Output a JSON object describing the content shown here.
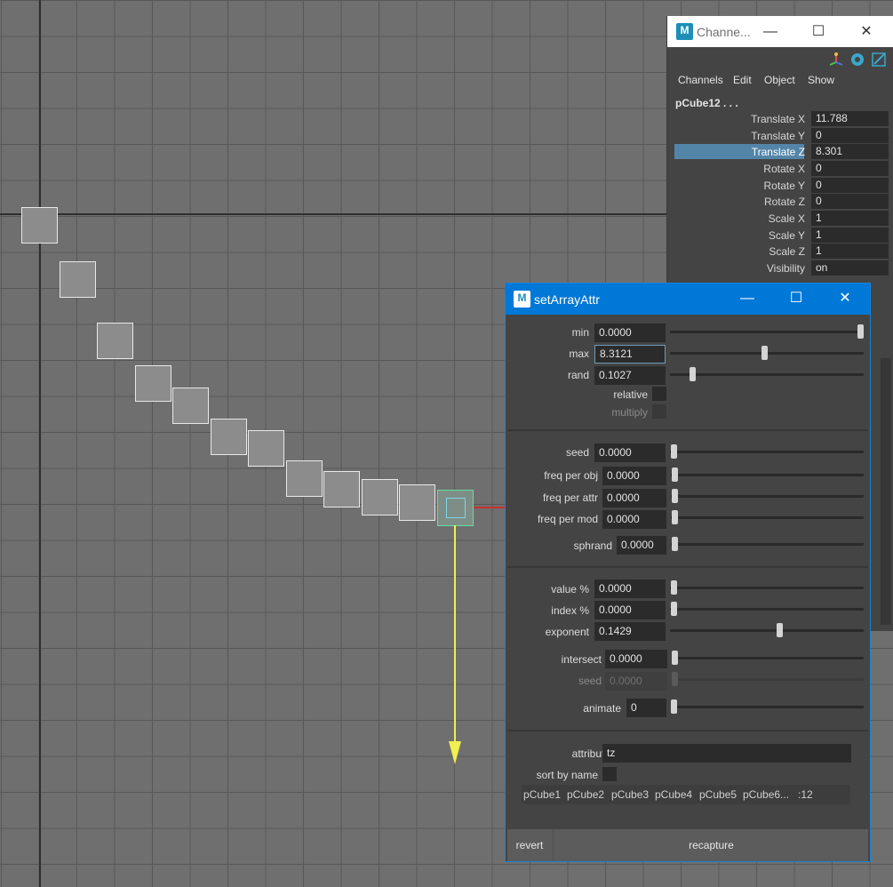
{
  "channel_box": {
    "title": "Channe...",
    "menu": [
      "Channels",
      "Edit",
      "Object",
      "Show"
    ],
    "node_name": "pCube12 . . .",
    "attributes": [
      {
        "label": "Translate X",
        "value": "11.788",
        "highlighted": false
      },
      {
        "label": "Translate Y",
        "value": "0",
        "highlighted": false
      },
      {
        "label": "Translate Z",
        "value": "8.301",
        "highlighted": true
      },
      {
        "label": "Rotate X",
        "value": "0",
        "highlighted": false
      },
      {
        "label": "Rotate Y",
        "value": "0",
        "highlighted": false
      },
      {
        "label": "Rotate Z",
        "value": "0",
        "highlighted": false
      },
      {
        "label": "Scale X",
        "value": "1",
        "highlighted": false
      },
      {
        "label": "Scale Y",
        "value": "1",
        "highlighted": false
      },
      {
        "label": "Scale Z",
        "value": "1",
        "highlighted": false
      },
      {
        "label": "Visibility",
        "value": "on",
        "highlighted": false
      }
    ]
  },
  "dialog": {
    "title": "setArrayAttr",
    "min": {
      "label": "min",
      "value": "0.0000",
      "slider": 1.0
    },
    "max": {
      "label": "max",
      "value": "8.3121",
      "slider": 0.5
    },
    "rand": {
      "label": "rand",
      "value": "0.1027",
      "slider": 0.1
    },
    "relative_label": "relative",
    "multiply_label": "multiply",
    "seed": {
      "label": "seed",
      "value": "0.0000",
      "slider": 0.0
    },
    "freq_obj": {
      "label": "freq per obj",
      "value": "0.0000",
      "slider": 0.0
    },
    "freq_attr": {
      "label": "freq per attr",
      "value": "0.0000",
      "slider": 0.0
    },
    "freq_mod": {
      "label": "freq per mod",
      "value": "0.0000",
      "slider": 0.0
    },
    "sphrand": {
      "label": "sphrand",
      "value": "0.0000",
      "slider": 0.0
    },
    "value_pct": {
      "label": "value %",
      "value": "0.0000",
      "slider": 0.0
    },
    "index_pct": {
      "label": "index %",
      "value": "0.0000",
      "slider": 0.0
    },
    "exponent": {
      "label": "exponent",
      "value": "0.1429",
      "slider": 0.57
    },
    "intersect": {
      "label": "intersect",
      "value": "0.0000",
      "slider": 0.0
    },
    "seed2": {
      "label": "seed",
      "value": "0.0000",
      "slider": 0.0
    },
    "animate": {
      "label": "animate",
      "value": "0",
      "slider": 0.0
    },
    "attributes_label": "attribute(s)",
    "attributes_value": "tz",
    "sort_label": "sort by name",
    "objects": [
      "pCube1",
      "pCube2",
      "pCube3",
      "pCube4",
      "pCube5",
      "pCube6..."
    ],
    "object_count": ":12",
    "revert_label": "revert",
    "recapture_label": "recapture"
  }
}
